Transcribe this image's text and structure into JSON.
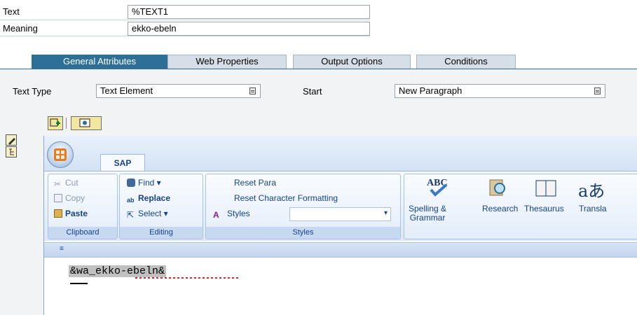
{
  "header": {
    "text_label": "Text",
    "text_value": "%TEXT1",
    "meaning_label": "Meaning",
    "meaning_value": "ekko-ebeln"
  },
  "tabs": [
    {
      "label": "General Attributes",
      "active": true
    },
    {
      "label": "Web Properties",
      "active": false
    },
    {
      "label": "Output Options",
      "active": false
    },
    {
      "label": "Conditions",
      "active": false
    }
  ],
  "form": {
    "text_type_label": "Text Type",
    "text_type_value": "Text Element",
    "start_label": "Start",
    "start_value": "New Paragraph"
  },
  "editor": {
    "ribbon_tab": "SAP",
    "clipboard": {
      "cut": "Cut",
      "copy": "Copy",
      "paste": "Paste",
      "group": "Clipboard"
    },
    "editing": {
      "find": "Find ▾",
      "replace": "Replace",
      "select": "Select ▾",
      "group": "Editing"
    },
    "styles": {
      "reset_para": "Reset Para",
      "reset_char": "Reset Character Formatting",
      "styles": "Styles",
      "group": "Styles"
    },
    "proofing": {
      "spelling": "Spelling &\nGrammar",
      "research": "Research",
      "thesaurus": "Thesaurus",
      "translate": "Transla"
    },
    "quick_access_symbol": "≡",
    "document_text": "&wa_ekko-ebeln&"
  },
  "colors": {
    "tab_active": "#2d6f97",
    "ribbon_text": "#15428b"
  }
}
